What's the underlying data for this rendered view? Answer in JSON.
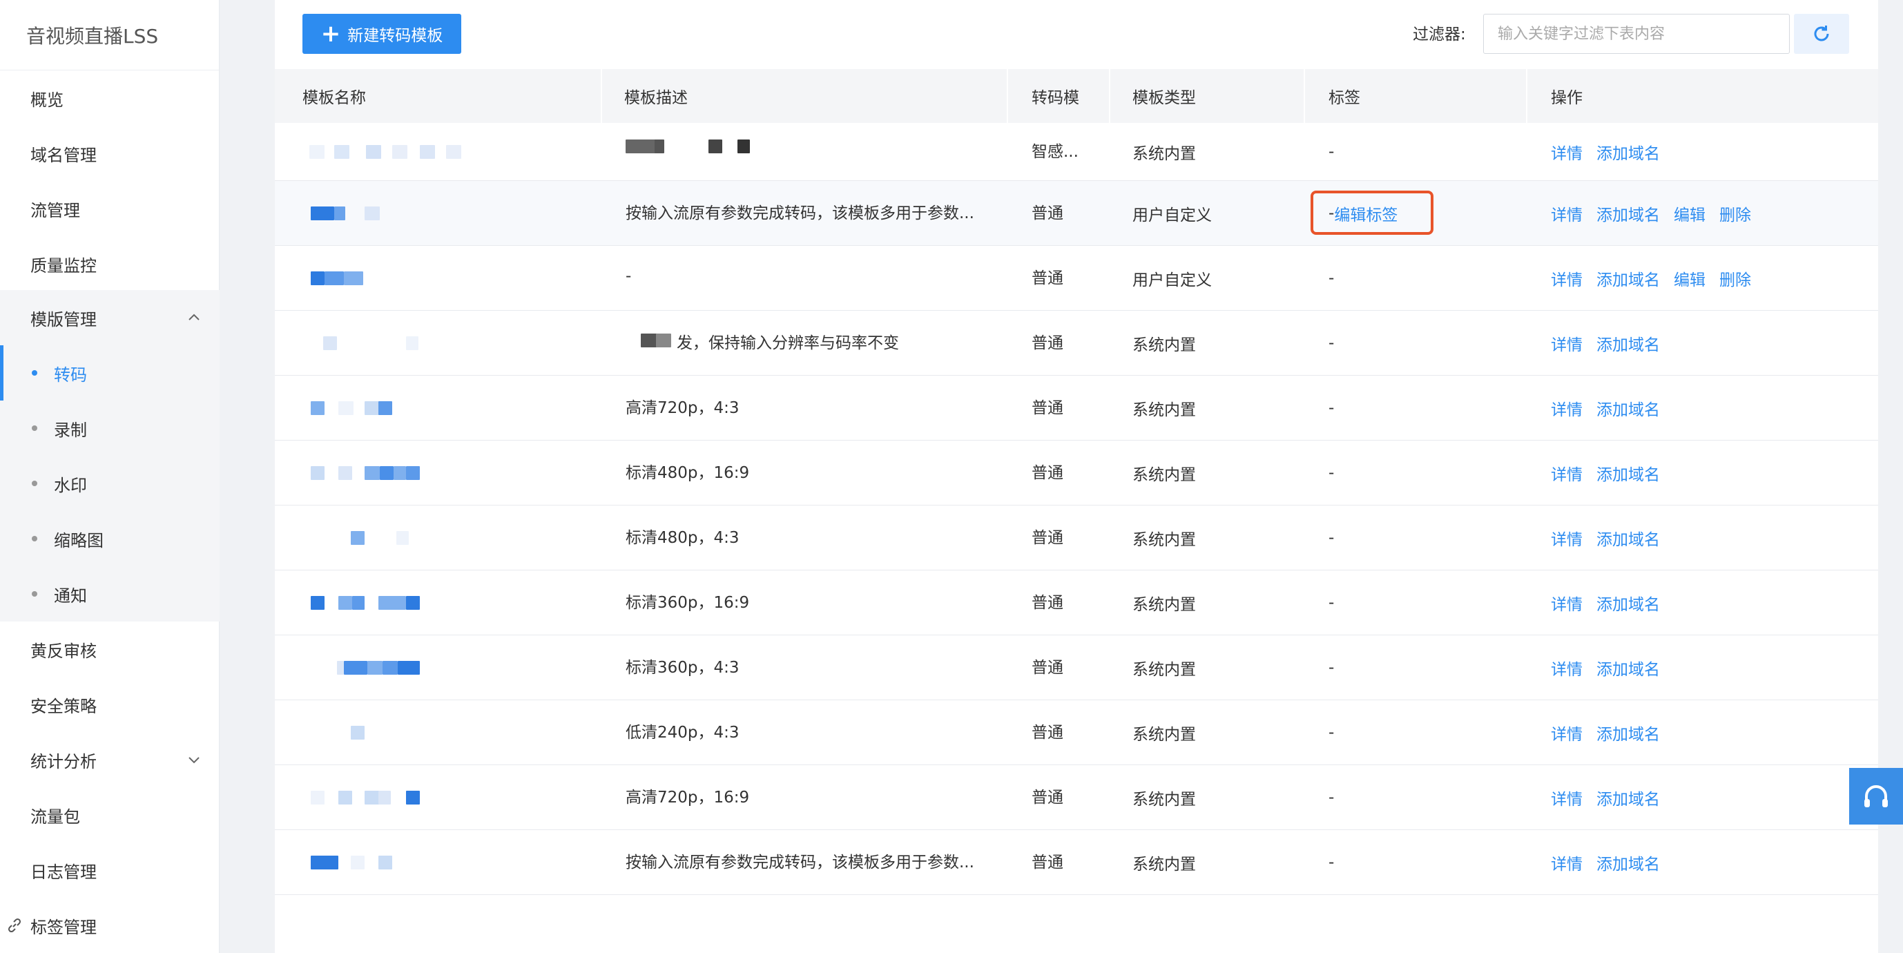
{
  "app": {
    "title": "音视频直播LSS"
  },
  "sidebar": {
    "items": [
      {
        "label": "概览"
      },
      {
        "label": "域名管理"
      },
      {
        "label": "流管理"
      },
      {
        "label": "质量监控"
      },
      {
        "label": "模版管理",
        "expanded": true,
        "children": [
          {
            "label": "转码",
            "active": true
          },
          {
            "label": "录制"
          },
          {
            "label": "水印"
          },
          {
            "label": "缩略图"
          },
          {
            "label": "通知"
          }
        ]
      },
      {
        "label": "黄反审核"
      },
      {
        "label": "安全策略"
      },
      {
        "label": "统计分析"
      },
      {
        "label": "流量包"
      },
      {
        "label": "日志管理"
      },
      {
        "label": "标签管理"
      }
    ]
  },
  "toolbar": {
    "new_button_label": "新建转码模板",
    "filter_label": "过滤器:",
    "filter_placeholder": "输入关键字过滤下表内容",
    "refresh_icon": "refresh-icon"
  },
  "table": {
    "headers": [
      "模板名称",
      "模板描述",
      "转码模",
      "模板类型",
      "标签",
      "操作"
    ],
    "rows": [
      {
        "name": "",
        "desc": "",
        "mode": "智感...",
        "type": "系统内置",
        "tag": "-",
        "actions": [
          "详情",
          "添加域名"
        ]
      },
      {
        "name": "",
        "desc": "按输入流原有参数完成转码，该模板多用于参数...",
        "mode": "普通",
        "type": "用户自定义",
        "tag": "-",
        "tag_edit": "编辑标签",
        "actions": [
          "详情",
          "添加域名",
          "编辑",
          "删除"
        ]
      },
      {
        "name": "",
        "desc": "-",
        "mode": "普通",
        "type": "用户自定义",
        "tag": "-",
        "actions": [
          "详情",
          "添加域名",
          "编辑",
          "删除"
        ]
      },
      {
        "name": "",
        "desc": "发，保持输入分辨率与码率不变",
        "mode": "普通",
        "type": "系统内置",
        "tag": "-",
        "actions": [
          "详情",
          "添加域名"
        ]
      },
      {
        "name": "",
        "desc": "高清720p，4:3",
        "mode": "普通",
        "type": "系统内置",
        "tag": "-",
        "actions": [
          "详情",
          "添加域名"
        ]
      },
      {
        "name": "",
        "desc": "标清480p，16:9",
        "mode": "普通",
        "type": "系统内置",
        "tag": "-",
        "actions": [
          "详情",
          "添加域名"
        ]
      },
      {
        "name": "",
        "desc": "标清480p，4:3",
        "mode": "普通",
        "type": "系统内置",
        "tag": "-",
        "actions": [
          "详情",
          "添加域名"
        ]
      },
      {
        "name": "",
        "desc": "标清360p，16:9",
        "mode": "普通",
        "type": "系统内置",
        "tag": "-",
        "actions": [
          "详情",
          "添加域名"
        ]
      },
      {
        "name": "",
        "desc": "标清360p，4:3",
        "mode": "普通",
        "type": "系统内置",
        "tag": "-",
        "actions": [
          "详情",
          "添加域名"
        ]
      },
      {
        "name": "",
        "desc": "低清240p，4:3",
        "mode": "普通",
        "type": "系统内置",
        "tag": "-",
        "actions": [
          "详情",
          "添加域名"
        ]
      },
      {
        "name": "",
        "desc": "高清720p，16:9",
        "mode": "普通",
        "type": "系统内置",
        "tag": "-",
        "actions": [
          "详情",
          "添加域名"
        ]
      },
      {
        "name": "",
        "desc": "按输入流原有参数完成转码，该模板多用于参数...",
        "mode": "普通",
        "type": "系统内置",
        "tag": "-",
        "actions": [
          "详情",
          "添加域名"
        ]
      }
    ]
  },
  "colors": {
    "accent": "#2d8cf0",
    "highlight_border": "#e8542a",
    "page_bg": "#f0f2f5"
  },
  "support": {
    "icon": "headset-icon"
  }
}
